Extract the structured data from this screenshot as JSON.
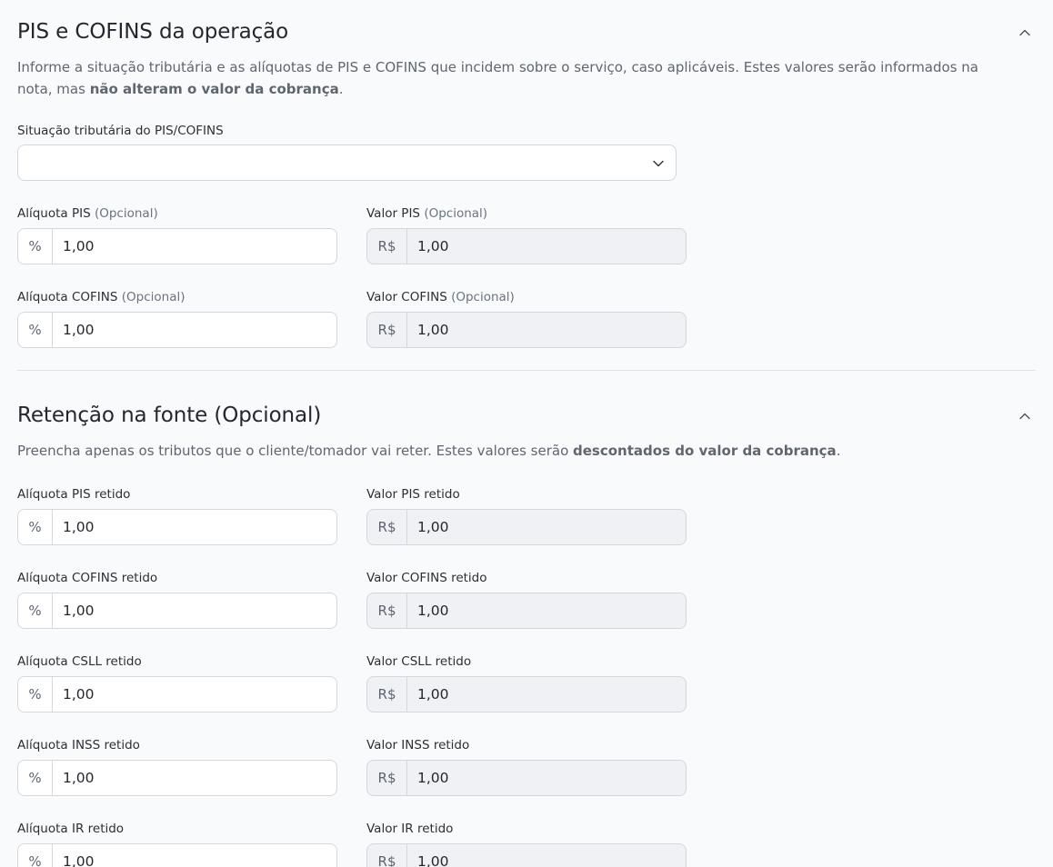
{
  "pis_cofins": {
    "title": "PIS e COFINS da operação",
    "desc_prefix": "Informe a situação tributária e as alíquotas de PIS e COFINS que incidem sobre o serviço, caso aplicáveis. Estes valores serão informados na nota, mas ",
    "desc_bold": "não alteram o valor da cobrança",
    "desc_suffix": ".",
    "situacao_label": "Situação tributária do PIS/COFINS",
    "situacao_value": "",
    "fields": [
      {
        "label": "Alíquota PIS",
        "optional": "(Opcional)",
        "addon": "%",
        "value": "1,00"
      },
      {
        "label": "Valor PIS",
        "optional": "(Opcional)",
        "addon": "R$",
        "value": "1,00"
      },
      {
        "label": "Alíquota COFINS",
        "optional": "(Opcional)",
        "addon": "%",
        "value": "1,00"
      },
      {
        "label": "Valor COFINS",
        "optional": "(Opcional)",
        "addon": "R$",
        "value": "1,00"
      }
    ]
  },
  "retencao": {
    "title": "Retenção na fonte (Opcional)",
    "desc_prefix": "Preencha apenas os tributos que o cliente/tomador vai reter. Estes valores serão ",
    "desc_bold": "descontados do valor da cobrança",
    "desc_suffix": ".",
    "fields": [
      {
        "label": "Alíquota PIS retido",
        "addon": "%",
        "value": "1,00"
      },
      {
        "label": "Valor PIS retido",
        "addon": "R$",
        "value": "1,00"
      },
      {
        "label": "Alíquota COFINS retido",
        "addon": "%",
        "value": "1,00"
      },
      {
        "label": "Valor COFINS retido",
        "addon": "R$",
        "value": "1,00"
      },
      {
        "label": "Alíquota CSLL retido",
        "addon": "%",
        "value": "1,00"
      },
      {
        "label": "Valor CSLL retido",
        "addon": "R$",
        "value": "1,00"
      },
      {
        "label": "Alíquota INSS retido",
        "addon": "%",
        "value": "1,00"
      },
      {
        "label": "Valor INSS retido",
        "addon": "R$",
        "value": "1,00"
      },
      {
        "label": "Alíquota IR retido",
        "addon": "%",
        "value": "1,00"
      },
      {
        "label": "Valor IR retido",
        "addon": "R$",
        "value": "1,00"
      }
    ]
  },
  "icons": {
    "collapse": "chevron-up-icon",
    "dropdown": "chevron-down-icon"
  },
  "colors": {
    "readonly_bg": "#f0f1f4",
    "border": "#d4d8de",
    "page_bg": "#f9fafb"
  }
}
